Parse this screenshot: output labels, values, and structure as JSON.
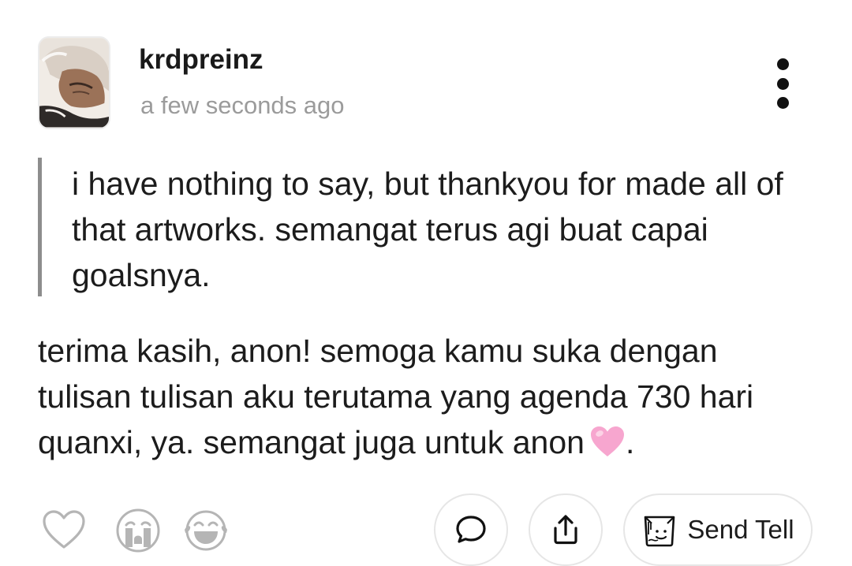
{
  "post": {
    "username": "krdpreinz",
    "timestamp": "a few seconds ago",
    "question": "i have nothing to say, but thankyou for made all of that artworks. semangat terus agi buat capai goalsnya.",
    "answer_text": "terima kasih, anon! semoga kamu suka dengan tulisan tulisan aku terutama yang agenda 730 hari quanxi, ya. semangat juga untuk anon",
    "answer_emoji": "pink-heart-emoji",
    "answer_end": "."
  },
  "actions": {
    "reactions": [
      "heart-icon",
      "crying-face-icon",
      "laughing-face-icon"
    ],
    "comment_icon": "speech-bubble-icon",
    "share_icon": "share-icon",
    "send_tell_label": "Send Tell",
    "send_tell_icon": "tell-bag-icon"
  },
  "colors": {
    "text": "#1c1c1c",
    "muted": "#9b9b9b",
    "quote_bar": "#8d8d8d",
    "icon_gray": "#b5b5b5",
    "heart_pink": "#f7a6cf"
  }
}
